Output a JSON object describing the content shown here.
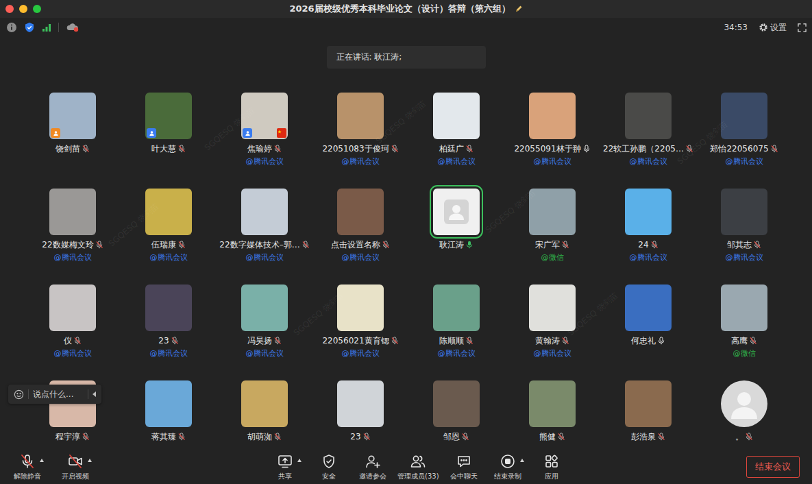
{
  "window": {
    "title": "2026届校级优秀本科毕业论文（设计）答辩（第六组）"
  },
  "status_bar": {
    "timer": "34:53",
    "settings": "设置"
  },
  "speaking_banner": "正在讲话: 耿江涛;",
  "watermark": "SGQESQ 饶剑苗",
  "participants": [
    {
      "name": "饶剑苗",
      "muted": true,
      "speaking": false,
      "avatar": "photo",
      "color": "#9fb3c8",
      "role": "host",
      "flag": false
    },
    {
      "name": "叶大慧",
      "muted": true,
      "speaking": false,
      "avatar": "photo",
      "color": "#4a6b3a",
      "role": "cohost",
      "flag": false
    },
    {
      "name": "焦瑜婷",
      "source": {
        "text": "@腾讯会议",
        "color": "#3d7bf0"
      },
      "muted": true,
      "speaking": false,
      "avatar": "photo",
      "color": "#cfcac0",
      "role": "cohost",
      "flag": true
    },
    {
      "name": "22051083于俊珂",
      "source": {
        "text": "@腾讯会议",
        "color": "#3d7bf0"
      },
      "muted": true,
      "speaking": false,
      "avatar": "photo",
      "color": "#b8926a",
      "role": "member",
      "flag": false
    },
    {
      "name": "柏廷广",
      "source": {
        "text": "@腾讯会议",
        "color": "#3d7bf0"
      },
      "muted": true,
      "speaking": false,
      "avatar": "photo",
      "color": "#e3e8ec",
      "role": "member",
      "flag": false
    },
    {
      "name": "22055091林于翀",
      "source": {
        "text": "@腾讯会议",
        "color": "#3d7bf0"
      },
      "muted": false,
      "speaking": false,
      "avatar": "photo",
      "color": "#d9a27a",
      "role": "member",
      "flag": false
    },
    {
      "name": "22软工孙鹏（2205…",
      "source": {
        "text": "@腾讯会议",
        "color": "#3d7bf0"
      },
      "muted": true,
      "speaking": false,
      "avatar": "photo",
      "color": "#4a4a48",
      "role": "member",
      "flag": false
    },
    {
      "name": "郑怡22056075",
      "source": {
        "text": "@腾讯会议",
        "color": "#3d7bf0"
      },
      "muted": true,
      "speaking": false,
      "avatar": "photo",
      "color": "#3a4a66",
      "role": "member",
      "flag": false
    },
    {
      "name": "22数媒梅文玲",
      "source": {
        "text": "@腾讯会议",
        "color": "#3d7bf0"
      },
      "muted": true,
      "speaking": false,
      "avatar": "photo",
      "color": "#9a9896",
      "role": "member",
      "flag": false
    },
    {
      "name": "伍瑞康",
      "source": {
        "text": "@腾讯会议",
        "color": "#3d7bf0"
      },
      "muted": true,
      "speaking": false,
      "avatar": "photo",
      "color": "#c9b04a",
      "role": "member",
      "flag": false
    },
    {
      "name": "22数字媒体技术–郭…",
      "source": {
        "text": "@腾讯会议",
        "color": "#3d7bf0"
      },
      "muted": true,
      "speaking": false,
      "avatar": "photo",
      "color": "#c4ccd6",
      "role": "member",
      "flag": false
    },
    {
      "name": "点击设置名称",
      "source": {
        "text": "@腾讯会议",
        "color": "#3d7bf0"
      },
      "muted": true,
      "speaking": false,
      "avatar": "photo",
      "color": "#7a5a48",
      "role": "member",
      "flag": false
    },
    {
      "name": "耿江涛",
      "muted": false,
      "speaking": true,
      "avatar": "default",
      "color": "#f0f0f0",
      "role": "member",
      "flag": false
    },
    {
      "name": "宋广军",
      "source": {
        "text": "@微信",
        "color": "#2fb34a"
      },
      "muted": true,
      "speaking": false,
      "avatar": "photo",
      "color": "#8fa0a8",
      "role": "member",
      "flag": false
    },
    {
      "name": "24",
      "source": {
        "text": "@腾讯会议",
        "color": "#3d7bf0"
      },
      "muted": true,
      "speaking": false,
      "avatar": "photo",
      "color": "#5ab0e8",
      "role": "member",
      "flag": false
    },
    {
      "name": "邹其志",
      "source": {
        "text": "@腾讯会议",
        "color": "#3d7bf0"
      },
      "muted": true,
      "speaking": false,
      "avatar": "photo",
      "color": "#3c3f44",
      "role": "member",
      "flag": false
    },
    {
      "name": "仪",
      "source": {
        "text": "@腾讯会议",
        "color": "#3d7bf0"
      },
      "muted": true,
      "speaking": false,
      "avatar": "photo",
      "color": "#c8c4c4",
      "role": "member",
      "flag": false
    },
    {
      "name": "23",
      "source": {
        "text": "@腾讯会议",
        "color": "#3d7bf0"
      },
      "muted": true,
      "speaking": false,
      "avatar": "photo",
      "color": "#4a4458",
      "role": "member",
      "flag": false
    },
    {
      "name": "冯昊扬",
      "source": {
        "text": "@腾讯会议",
        "color": "#3d7bf0"
      },
      "muted": true,
      "speaking": false,
      "avatar": "photo",
      "color": "#7ab0a8",
      "role": "member",
      "flag": false
    },
    {
      "name": "22056021黄育锶",
      "source": {
        "text": "@腾讯会议",
        "color": "#3d7bf0"
      },
      "muted": true,
      "speaking": false,
      "avatar": "photo",
      "color": "#e8e2c8",
      "role": "member",
      "flag": false
    },
    {
      "name": "陈顺顺",
      "source": {
        "text": "@腾讯会议",
        "color": "#3d7bf0"
      },
      "muted": true,
      "speaking": false,
      "avatar": "photo",
      "color": "#6aa08a",
      "role": "member",
      "flag": false
    },
    {
      "name": "黄翰涛",
      "source": {
        "text": "@腾讯会议",
        "color": "#3d7bf0"
      },
      "muted": true,
      "speaking": false,
      "avatar": "photo",
      "color": "#e0e0dc",
      "role": "member",
      "flag": false
    },
    {
      "name": "何忠礼",
      "muted": false,
      "speaking": false,
      "avatar": "photo",
      "color": "#3a6ec0",
      "role": "member",
      "flag": false
    },
    {
      "name": "高鹰",
      "source": {
        "text": "@微信",
        "color": "#2fb34a"
      },
      "muted": true,
      "speaking": false,
      "avatar": "photo",
      "color": "#9aa8b0",
      "role": "member",
      "flag": false
    },
    {
      "name": "程宇淳",
      "muted": true,
      "speaking": false,
      "avatar": "photo",
      "color": "#d8b8a8",
      "role": "member",
      "flag": false
    },
    {
      "name": "蒋其臻",
      "muted": true,
      "speaking": false,
      "avatar": "photo",
      "color": "#6aa8d8",
      "role": "member",
      "flag": false
    },
    {
      "name": "胡萌洳",
      "muted": true,
      "speaking": false,
      "avatar": "photo",
      "color": "#c8a860",
      "role": "member",
      "flag": false
    },
    {
      "name": "23",
      "muted": true,
      "speaking": false,
      "avatar": "photo",
      "color": "#d0d4d8",
      "role": "member",
      "flag": false
    },
    {
      "name": "邹恩",
      "muted": true,
      "speaking": false,
      "avatar": "photo",
      "color": "#6a5a4e",
      "role": "member",
      "flag": false
    },
    {
      "name": "熊健",
      "muted": true,
      "speaking": false,
      "avatar": "photo",
      "color": "#7a8a6a",
      "role": "member",
      "flag": false
    },
    {
      "name": "彭浩泉",
      "muted": true,
      "speaking": false,
      "avatar": "photo",
      "color": "#8a6a4e",
      "role": "member",
      "flag": false
    },
    {
      "name": "。",
      "muted": true,
      "speaking": false,
      "avatar": "round",
      "color": "#d9d9d9",
      "role": "member",
      "flag": false
    }
  ],
  "chat_input": {
    "placeholder": "说点什么..."
  },
  "toolbar": {
    "left": [
      {
        "label": "解除静音",
        "kind": "mic",
        "off": true,
        "menu": true
      },
      {
        "label": "开启视频",
        "kind": "video",
        "off": true,
        "menu": true
      }
    ],
    "center": [
      {
        "label": "共享",
        "kind": "share",
        "off": false,
        "menu": true
      },
      {
        "label": "安全",
        "kind": "security",
        "off": false,
        "menu": false
      },
      {
        "label": "邀请参会",
        "kind": "invite",
        "off": false,
        "menu": false
      },
      {
        "label": "管理成员(33)",
        "kind": "members",
        "off": false,
        "menu": false
      },
      {
        "label": "会中聊天",
        "kind": "chat",
        "off": false,
        "menu": false
      },
      {
        "label": "结束录制",
        "kind": "record",
        "off": false,
        "menu": true
      },
      {
        "label": "应用",
        "kind": "apps",
        "off": false,
        "menu": false
      }
    ],
    "end_button": "结束会议"
  }
}
